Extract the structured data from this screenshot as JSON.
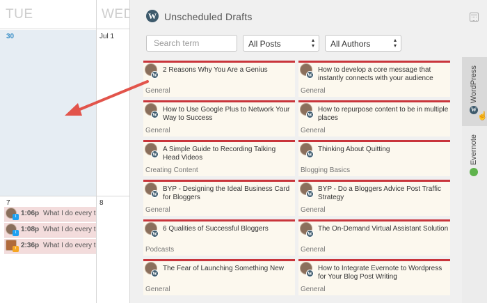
{
  "calendar": {
    "day_names": [
      "TUE",
      "WED"
    ],
    "dates": [
      "30",
      "Jul 1",
      "7",
      "8"
    ],
    "events": [
      {
        "time": "1:06p",
        "title": "What I do every time",
        "badge": "twitter"
      },
      {
        "time": "1:08p",
        "title": "What I do every time",
        "badge": "twitter"
      },
      {
        "time": "2:36p",
        "title": "What I do every time",
        "badge": "rss"
      }
    ]
  },
  "panel": {
    "title": "Unscheduled Drafts",
    "search_placeholder": "Search term",
    "filter_posts": "All Posts",
    "filter_authors": "All Authors",
    "wp_glyph": "W",
    "tabs": [
      {
        "label": "WordPress"
      },
      {
        "label": "Evernote"
      }
    ]
  },
  "drafts": [
    {
      "title": "2 Reasons Why You Are a Genius",
      "category": "General"
    },
    {
      "title": "How to develop a core message that instantly connects with your audience",
      "category": "General"
    },
    {
      "title": "How to Use Google Plus to Network Your Way to Success",
      "category": "General"
    },
    {
      "title": "How to repurpose content to be in multiple places",
      "category": "General"
    },
    {
      "title": "A Simple Guide to Recording Talking Head Videos",
      "category": "Creating Content"
    },
    {
      "title": "Thinking About Quitting",
      "category": "Blogging Basics"
    },
    {
      "title": "BYP - Designing the Ideal Business Card for Bloggers",
      "category": "General"
    },
    {
      "title": "BYP - Do a Bloggers Advice Post Traffic Strategy",
      "category": "General"
    },
    {
      "title": "6 Qualities of Successful Bloggers",
      "category": "Podcasts"
    },
    {
      "title": "The On-Demand Virtual Assistant Solution",
      "category": "General"
    },
    {
      "title": "The Fear of Launching Something New",
      "category": "General"
    },
    {
      "title": "How to Integrate Evernote to Wordpress for Your Blog Post Writing",
      "category": "General"
    }
  ],
  "colors": {
    "accent_red": "#c9353b",
    "arrow": "#e2544b",
    "wp_blue": "#3d5a6c"
  }
}
